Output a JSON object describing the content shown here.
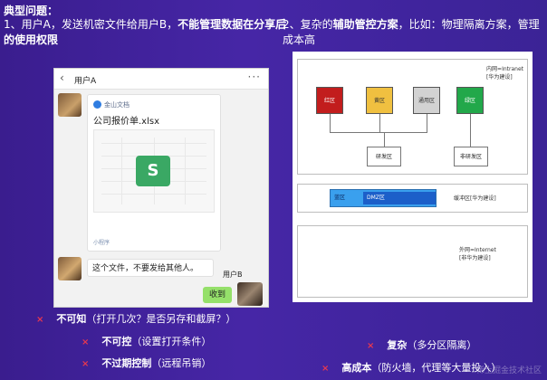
{
  "header": {
    "title": "典型问题：",
    "left_plain": "1、用户A，发送机密文件给用户B，",
    "left_bold": "不能管理数据在分享后的使用权限",
    "right_plain1": "2、复杂的",
    "right_bold": "辅助管控方案",
    "right_plain2": "，比如：物理隔离方案，管理成本高"
  },
  "phone": {
    "back_icon": "‹",
    "contact": "用户A",
    "menu_icon": "···",
    "brand": "金山文档",
    "file_name": "公司报价单.xlsx",
    "sheet_letter": "S",
    "card_footer": "小程序",
    "message": "这个文件，不要发给其他人。",
    "user_b": "用户B",
    "reply": "收到"
  },
  "diagram": {
    "intranet_label": "内网=Intranet",
    "intranet_sub": "[华为建设]",
    "zones": [
      "红区",
      "黄区",
      "通用区",
      "绿区"
    ],
    "sub_left": "研发区",
    "sub_right": "非研发区",
    "buffer_blue": "蓝区",
    "buffer_dmz": "DMZ区",
    "buffer_label": "缓冲区[华为建设]",
    "extranet_label": "外网=Internet",
    "extranet_sub": "[非华为建设]",
    "colors": {
      "red": "#c21d1d",
      "yellow": "#f0c040",
      "gray": "#d2d2d2",
      "green": "#22a84a",
      "blue": "#3aa0ee"
    }
  },
  "bullets_left": [
    {
      "bold": "不可知",
      "rest": "（打开几次？是否另存和截屏？）"
    },
    {
      "bold": "不可控",
      "rest": "（设置打开条件）"
    },
    {
      "bold": "不过期控制",
      "rest": "（远程吊销）"
    }
  ],
  "bullets_right": [
    {
      "bold": "复杂",
      "rest": "（多分区隔离）"
    },
    {
      "bold": "高成本",
      "rest": "（防火墙，代理等大量投入）"
    }
  ],
  "bullet_mark": "×",
  "watermark": "稀土掘金技术社区"
}
